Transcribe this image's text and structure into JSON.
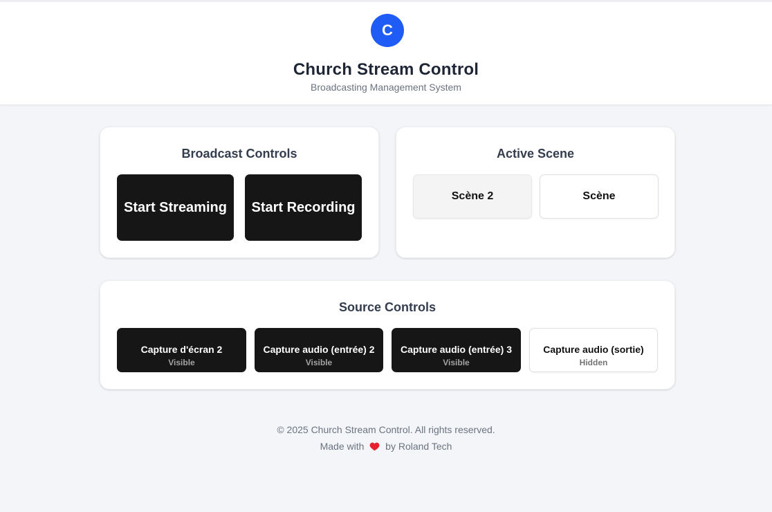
{
  "header": {
    "logo_letter": "C",
    "title": "Church Stream Control",
    "subtitle": "Broadcasting Management System",
    "accent_color": "#1f5cf5"
  },
  "broadcast": {
    "title": "Broadcast Controls",
    "start_streaming_label": "Start Streaming",
    "start_recording_label": "Start Recording"
  },
  "scene": {
    "title": "Active Scene",
    "scenes": [
      {
        "label": "Scène 2",
        "active": true
      },
      {
        "label": "Scène",
        "active": false
      }
    ]
  },
  "sources": {
    "title": "Source Controls",
    "items": [
      {
        "name": "Capture d'écran 2",
        "status": "Visible"
      },
      {
        "name": "Capture audio (entrée) 2",
        "status": "Visible"
      },
      {
        "name": "Capture audio (entrée) 3",
        "status": "Visible"
      },
      {
        "name": "Capture audio (sortie)",
        "status": "Hidden"
      }
    ]
  },
  "footer": {
    "copyright": "© 2025 Church Stream Control. All rights reserved.",
    "made_with": "Made with",
    "by_text": "by Roland Tech",
    "heart_icon": "heart-icon",
    "heart_color": "#e5232f"
  }
}
